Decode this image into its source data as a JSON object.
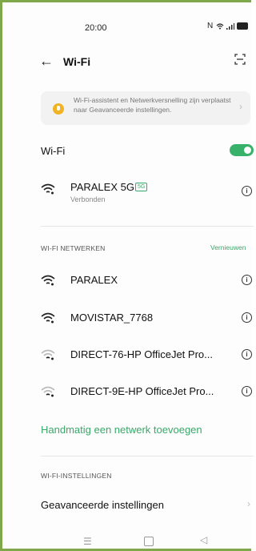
{
  "status_bar": {
    "time": "20:00",
    "icons": [
      "nfc-icon",
      "wifi-icon",
      "signal-icon",
      "battery-icon"
    ]
  },
  "header": {
    "title": "Wi-Fi",
    "back_icon": "arrow-left-icon",
    "scan_icon": "scan-qr-icon"
  },
  "tip": {
    "text": "Wi-Fi-assistent en Netwerkversnelling zijn verplaatst naar Geavanceerde instellingen."
  },
  "wifi_toggle": {
    "label": "Wi-Fi",
    "enabled": true
  },
  "connected": {
    "name": "PARALEX 5G",
    "badge": "5G",
    "status": "Verbonden"
  },
  "networks_section": {
    "title": "WI-FI NETWERKEN",
    "refresh_label": "Vernieuwen",
    "items": [
      {
        "name": "PARALEX",
        "signal": "strong"
      },
      {
        "name": "MOVISTAR_7768",
        "signal": "strong"
      },
      {
        "name": "DIRECT-76-HP OfficeJet Pro...",
        "signal": "weak"
      },
      {
        "name": "DIRECT-9E-HP OfficeJet Pro...",
        "signal": "weak"
      }
    ]
  },
  "manual_add_label": "Handmatig een netwerk toevoegen",
  "settings_section": {
    "title": "WI-FI-INSTELLINGEN",
    "advanced_label": "Geavanceerde instellingen"
  },
  "colors": {
    "accent": "#38b26a",
    "bulb": "#f0b323"
  }
}
